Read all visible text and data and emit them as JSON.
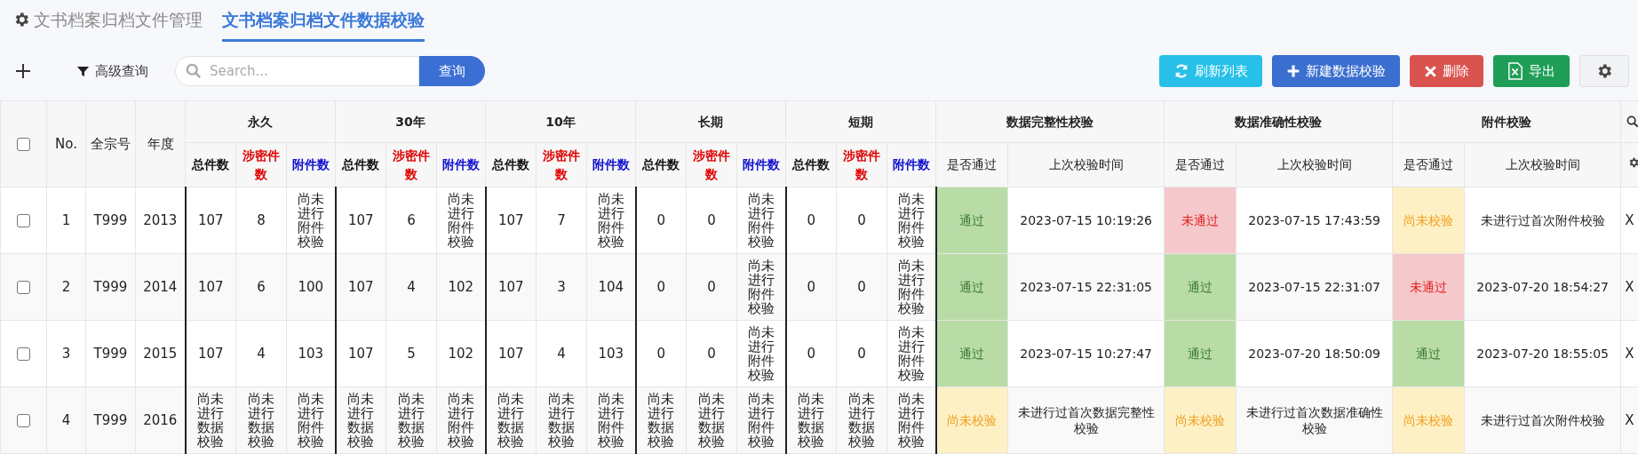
{
  "tabs": [
    {
      "label": "文书档案归档文件管理",
      "selected": false
    },
    {
      "label": "文书档案归档文件数据校验",
      "selected": true
    }
  ],
  "toolbar": {
    "advanced_search": "高级查询",
    "search": {
      "placeholder": "Search..."
    },
    "search_button": "查询",
    "buttons": [
      {
        "label": "刷新列表",
        "kind": "refresh"
      },
      {
        "label": "新建数据校验",
        "kind": "create"
      },
      {
        "label": "删除",
        "kind": "delete"
      },
      {
        "label": "导出",
        "kind": "export"
      },
      {
        "kind": "settings"
      }
    ]
  },
  "table": {
    "select_all_checked": false,
    "columns": [
      "No.",
      "全宗号",
      "年度"
    ],
    "retention_groups": [
      {
        "label": "永久",
        "subcolumns": [
          {
            "label": "总件数",
            "kind": "total"
          },
          {
            "label": "涉密件数",
            "kind": "secret"
          },
          {
            "label": "附件数",
            "kind": "attachment"
          }
        ]
      },
      {
        "label": "30年",
        "subcolumns": [
          {
            "label": "总件数",
            "kind": "total"
          },
          {
            "label": "涉密件数",
            "kind": "secret"
          },
          {
            "label": "附件数",
            "kind": "attachment"
          }
        ]
      },
      {
        "label": "10年",
        "subcolumns": [
          {
            "label": "总件数",
            "kind": "total"
          },
          {
            "label": "涉密件数",
            "kind": "secret"
          },
          {
            "label": "附件数",
            "kind": "attachment"
          }
        ]
      },
      {
        "label": "长期",
        "subcolumns": [
          {
            "label": "总件数",
            "kind": "total"
          },
          {
            "label": "涉密件数",
            "kind": "secret"
          },
          {
            "label": "附件数",
            "kind": "attachment"
          }
        ]
      },
      {
        "label": "短期",
        "subcolumns": [
          {
            "label": "总件数",
            "kind": "total"
          },
          {
            "label": "涉密件数",
            "kind": "secret"
          },
          {
            "label": "附件数",
            "kind": "attachment"
          }
        ]
      }
    ],
    "check_groups": [
      {
        "label": "数据完整性校验",
        "subcolumns": [
          "是否通过",
          "上次校验时间"
        ]
      },
      {
        "label": "数据准确性校验",
        "subcolumns": [
          "是否通过",
          "上次校验时间"
        ]
      },
      {
        "label": "附件校验",
        "subcolumns": [
          "是否通过",
          "上次校验时间"
        ]
      }
    ],
    "rows": [
      {
        "checked": false,
        "no": "1",
        "fonds": "T999",
        "year": "2013",
        "retention": [
          [
            "107",
            "8",
            "尚未进行附件校验"
          ],
          [
            "107",
            "6",
            "尚未进行附件校验"
          ],
          [
            "107",
            "7",
            "尚未进行附件校验"
          ],
          [
            "0",
            "0",
            "尚未进行附件校验"
          ],
          [
            "0",
            "0",
            "尚未进行附件校验"
          ]
        ],
        "checks": [
          {
            "status": "通过",
            "kind": "pass",
            "time": "2023-07-15 10:19:26"
          },
          {
            "status": "未通过",
            "kind": "fail",
            "time": "2023-07-15 17:43:59"
          },
          {
            "status": "尚未校验",
            "kind": "pending",
            "time": "未进行过首次附件校验"
          }
        ],
        "column_last": "X"
      },
      {
        "checked": false,
        "no": "2",
        "fonds": "T999",
        "year": "2014",
        "retention": [
          [
            "107",
            "6",
            "100"
          ],
          [
            "107",
            "4",
            "102"
          ],
          [
            "107",
            "3",
            "104"
          ],
          [
            "0",
            "0",
            "尚未进行附件校验"
          ],
          [
            "0",
            "0",
            "尚未进行附件校验"
          ]
        ],
        "checks": [
          {
            "status": "通过",
            "kind": "pass",
            "time": "2023-07-15 22:31:05"
          },
          {
            "status": "通过",
            "kind": "pass",
            "time": "2023-07-15 22:31:07"
          },
          {
            "status": "未通过",
            "kind": "fail",
            "time": "2023-07-20 18:54:27"
          }
        ],
        "column_last": "X"
      },
      {
        "checked": false,
        "no": "3",
        "fonds": "T999",
        "year": "2015",
        "retention": [
          [
            "107",
            "4",
            "103"
          ],
          [
            "107",
            "5",
            "102"
          ],
          [
            "107",
            "4",
            "103"
          ],
          [
            "0",
            "0",
            "尚未进行附件校验"
          ],
          [
            "0",
            "0",
            "尚未进行附件校验"
          ]
        ],
        "checks": [
          {
            "status": "通过",
            "kind": "pass",
            "time": "2023-07-15 10:27:47"
          },
          {
            "status": "通过",
            "kind": "pass",
            "time": "2023-07-20 18:50:09"
          },
          {
            "status": "通过",
            "kind": "pass",
            "time": "2023-07-20 18:55:05"
          }
        ],
        "column_last": "X"
      },
      {
        "checked": false,
        "no": "4",
        "fonds": "T999",
        "year": "2016",
        "retention": [
          [
            "尚未进行数据校验",
            "尚未进行数据校验",
            "尚未进行附件校验"
          ],
          [
            "尚未进行数据校验",
            "尚未进行数据校验",
            "尚未进行附件校验"
          ],
          [
            "尚未进行数据校验",
            "尚未进行数据校验",
            "尚未进行附件校验"
          ],
          [
            "尚未进行数据校验",
            "尚未进行数据校验",
            "尚未进行附件校验"
          ],
          [
            "尚未进行数据校验",
            "尚未进行数据校验",
            "尚未进行附件校验"
          ]
        ],
        "checks": [
          {
            "status": "尚未校验",
            "kind": "pending",
            "time": "未进行过首次数据完整性校验"
          },
          {
            "status": "尚未校验",
            "kind": "pending",
            "time": "未进行过首次数据准确性校验"
          },
          {
            "status": "尚未校验",
            "kind": "pending",
            "time": "未进行过首次附件校验"
          }
        ],
        "column_last": "X"
      }
    ]
  }
}
